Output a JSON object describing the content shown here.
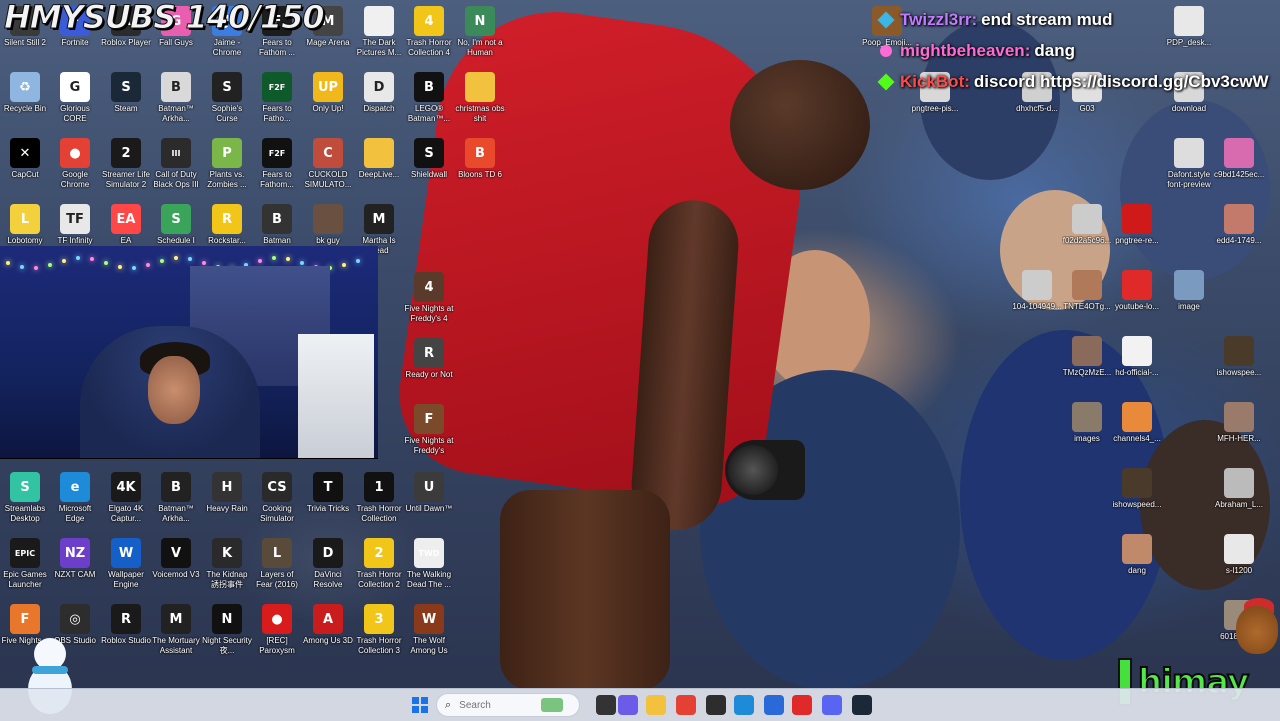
{
  "subs_counter": "HMYSUBS 140/150",
  "chat": [
    {
      "name": "Twizzl3rr:",
      "message": "end stream mud",
      "color": "#c07bff"
    },
    {
      "name": "mightbeheaven:",
      "message": "dang",
      "color": "#ff6bd6"
    },
    {
      "name": "KickBot:",
      "message": "discord https://discord.gg/Cbv3cwW",
      "color": "#ff4a4a"
    }
  ],
  "desktop_icons_left": [
    {
      "label": "Silent Still 2",
      "icon": "game-icon",
      "color": "#3a3a3a",
      "glyph": "S"
    },
    {
      "label": "Fortnite",
      "icon": "fortnite-icon",
      "color": "#3b5bd8",
      "glyph": "F"
    },
    {
      "label": "Roblox Player",
      "icon": "roblox-icon",
      "color": "#2b2b2b",
      "glyph": "R"
    },
    {
      "label": "Fall Guys",
      "icon": "fallguys-icon",
      "color": "#e85fb0",
      "glyph": "G"
    },
    {
      "label": "Jaime - Chrome",
      "icon": "chrome-icon",
      "color": "#3d7de0",
      "glyph": "J"
    },
    {
      "label": "Fears to Fathom ...",
      "icon": "game-icon",
      "color": "#1c1c1c",
      "glyph": "F"
    },
    {
      "label": "Mage Arena",
      "icon": "game-icon",
      "color": "#444",
      "glyph": "M"
    },
    {
      "label": "The Dark Pictures M...",
      "icon": "document-icon",
      "color": "#f0f0f0",
      "glyph": ""
    },
    {
      "label": "Trash Horror Collection 4",
      "icon": "game-icon",
      "color": "#f2c619",
      "glyph": "4"
    },
    {
      "label": "No, I'm not a Human",
      "icon": "game-icon",
      "color": "#3a8a5a",
      "glyph": "N"
    },
    {
      "label": "Recycle Bin",
      "icon": "recycle-bin-icon",
      "color": "#8fb6e0",
      "glyph": "♻"
    },
    {
      "label": "Glorious CORE",
      "icon": "glorious-icon",
      "color": "#ffffff",
      "glyph": "G"
    },
    {
      "label": "Steam",
      "icon": "steam-icon",
      "color": "#1b2838",
      "glyph": "S"
    },
    {
      "label": "Batman™ Arkha...",
      "icon": "game-icon",
      "color": "#d9d9d9",
      "glyph": "B"
    },
    {
      "label": "Sophie's Curse",
      "icon": "game-icon",
      "color": "#222",
      "glyph": "S"
    },
    {
      "label": "Fears to Fatho...",
      "icon": "game-icon",
      "color": "#0f5a2a",
      "glyph": "F2F"
    },
    {
      "label": "Only Up!",
      "icon": "game-icon",
      "color": "#f0b81a",
      "glyph": "UP"
    },
    {
      "label": "Dispatch",
      "icon": "game-icon",
      "color": "#e8e8e8",
      "glyph": "D"
    },
    {
      "label": "LEGO® Batman™...",
      "icon": "game-icon",
      "color": "#111",
      "glyph": "B"
    },
    {
      "label": "christmas obs shit",
      "icon": "folder-icon",
      "color": "#f2c13d",
      "glyph": ""
    },
    {
      "label": "CapCut",
      "icon": "capcut-icon",
      "color": "#000",
      "glyph": "✕"
    },
    {
      "label": "Google Chrome",
      "icon": "chrome-icon",
      "color": "#e44134",
      "glyph": "●"
    },
    {
      "label": "Streamer Life Simulator 2",
      "icon": "game-icon",
      "color": "#1a1a1a",
      "glyph": "2"
    },
    {
      "label": "Call of Duty Black Ops III",
      "icon": "game-icon",
      "color": "#2b2b2b",
      "glyph": "III"
    },
    {
      "label": "Plants vs. Zombies ...",
      "icon": "game-icon",
      "color": "#7ab648",
      "glyph": "P"
    },
    {
      "label": "Fears to Fathom...",
      "icon": "game-icon",
      "color": "#111",
      "glyph": "F2F"
    },
    {
      "label": "CUCKOLD SIMULATO...",
      "icon": "game-icon",
      "color": "#c04c3c",
      "glyph": "C"
    },
    {
      "label": "DeepLive...",
      "icon": "folder-icon",
      "color": "#f2c13d",
      "glyph": ""
    },
    {
      "label": "Shieldwall",
      "icon": "game-icon",
      "color": "#111",
      "glyph": "S"
    },
    {
      "label": "Bloons TD 6",
      "icon": "game-icon",
      "color": "#e84a2b",
      "glyph": "B"
    },
    {
      "label": "Lobotomy",
      "icon": "game-icon",
      "color": "#f2d13d",
      "glyph": "L"
    },
    {
      "label": "TF Infinity",
      "icon": "game-icon",
      "color": "#e8e8e8",
      "glyph": "TF"
    },
    {
      "label": "EA",
      "icon": "ea-icon",
      "color": "#ff4747",
      "glyph": "EA"
    },
    {
      "label": "Schedule I",
      "icon": "game-icon",
      "color": "#3aa45a",
      "glyph": "S"
    },
    {
      "label": "Rockstar...",
      "icon": "rockstar-icon",
      "color": "#f2c619",
      "glyph": "R"
    },
    {
      "label": "Batman The...",
      "icon": "game-icon",
      "color": "#333",
      "glyph": "B"
    },
    {
      "label": "bk guy",
      "icon": "image-icon",
      "color": "#6a5040",
      "glyph": ""
    },
    {
      "label": "Martha Is Dead",
      "icon": "game-icon",
      "color": "#222",
      "glyph": "M"
    }
  ],
  "desktop_icons_bottom": [
    {
      "label": "Streamlabs Desktop",
      "icon": "streamlabs-icon",
      "color": "#31c3a2",
      "glyph": "S"
    },
    {
      "label": "Microsoft Edge",
      "icon": "edge-icon",
      "color": "#1e8bd8",
      "glyph": "e"
    },
    {
      "label": "Elgato 4K Captur...",
      "icon": "elgato-icon",
      "color": "#1a1a1a",
      "glyph": "4K"
    },
    {
      "label": "Batman™ Arkha...",
      "icon": "game-icon",
      "color": "#222",
      "glyph": "B"
    },
    {
      "label": "Heavy Rain",
      "icon": "game-icon",
      "color": "#333",
      "glyph": "H"
    },
    {
      "label": "Cooking Simulator",
      "icon": "game-icon",
      "color": "#2a2a2a",
      "glyph": "CS"
    },
    {
      "label": "Trivia Tricks",
      "icon": "game-icon",
      "color": "#111",
      "glyph": "T"
    },
    {
      "label": "Trash Horror Collection",
      "icon": "game-icon",
      "color": "#111",
      "glyph": "1"
    },
    {
      "label": "Until Dawn™",
      "icon": "game-icon",
      "color": "#3b3b3b",
      "glyph": "U"
    },
    {
      "label": "Epic Games Launcher",
      "icon": "epic-icon",
      "color": "#1a1a1a",
      "glyph": "EPIC"
    },
    {
      "label": "NZXT CAM",
      "icon": "nzxt-icon",
      "color": "#6c3ec9",
      "glyph": "NZ"
    },
    {
      "label": "Wallpaper Engine",
      "icon": "wallpaper-engine-icon",
      "color": "#1560c8",
      "glyph": "W"
    },
    {
      "label": "Voicemod V3",
      "icon": "voicemod-icon",
      "color": "#111",
      "glyph": "V"
    },
    {
      "label": "The Kidnap 誘拐事件",
      "icon": "game-icon",
      "color": "#2a2a2a",
      "glyph": "K"
    },
    {
      "label": "Layers of Fear (2016)",
      "icon": "game-icon",
      "color": "#5a4a3a",
      "glyph": "L"
    },
    {
      "label": "DaVinci Resolve",
      "icon": "davinci-icon",
      "color": "#1a1a1a",
      "glyph": "D"
    },
    {
      "label": "Trash Horror Collection 2",
      "icon": "game-icon",
      "color": "#f2c619",
      "glyph": "2"
    },
    {
      "label": "The Walking Dead The ...",
      "icon": "game-icon",
      "color": "#eee",
      "glyph": "TWD"
    },
    {
      "label": "Five Nights...",
      "icon": "game-icon",
      "color": "#e8762b",
      "glyph": "F"
    },
    {
      "label": "OBS Studio",
      "icon": "obs-icon",
      "color": "#2d2d2d",
      "glyph": "◎"
    },
    {
      "label": "Roblox Studio",
      "icon": "roblox-studio-icon",
      "color": "#1a1a1a",
      "glyph": "R"
    },
    {
      "label": "The Mortuary Assistant",
      "icon": "game-icon",
      "color": "#222",
      "glyph": "M"
    },
    {
      "label": "Night Security 夜...",
      "icon": "game-icon",
      "color": "#111",
      "glyph": "N"
    },
    {
      "label": "[REC] Paroxysm",
      "icon": "game-icon",
      "color": "#d81b1b",
      "glyph": "●"
    },
    {
      "label": "Among Us 3D",
      "icon": "game-icon",
      "color": "#c91d1d",
      "glyph": "A"
    },
    {
      "label": "Trash Horror Collection 3",
      "icon": "game-icon",
      "color": "#f2c619",
      "glyph": "3"
    },
    {
      "label": "The Wolf Among Us",
      "icon": "game-icon",
      "color": "#8a3a1a",
      "glyph": "W"
    }
  ],
  "desktop_icons_middle": [
    {
      "label": "Five Nights at Freddy's 4",
      "icon": "game-icon",
      "color": "#5a3a2a",
      "glyph": "4"
    },
    {
      "label": "Ready or Not",
      "icon": "game-icon",
      "color": "#444",
      "glyph": "R"
    },
    {
      "label": "Five Nights at Freddy's",
      "icon": "game-icon",
      "color": "#7a4a2a",
      "glyph": "F"
    }
  ],
  "desktop_icons_right": [
    {
      "label": "Poop_Emoji...",
      "icon": "image-icon",
      "color": "#8a5a2a",
      "glyph": ""
    },
    {
      "label": "PDP_desk...",
      "icon": "image-icon",
      "color": "#e8e8e8",
      "glyph": ""
    },
    {
      "label": "pngtree-pis...",
      "icon": "image-icon",
      "color": "#d8d8d8",
      "glyph": ""
    },
    {
      "label": "dhxhcf5-d...",
      "icon": "image-icon",
      "color": "#d0d0d0",
      "glyph": ""
    },
    {
      "label": "G03",
      "icon": "image-icon",
      "color": "#e0e0e0",
      "glyph": ""
    },
    {
      "label": "download",
      "icon": "image-icon",
      "color": "#d8d8d8",
      "glyph": ""
    },
    {
      "label": "Dafont.style font-preview",
      "icon": "image-icon",
      "color": "#ddd",
      "glyph": ""
    },
    {
      "label": "c9bd1425ec...",
      "icon": "image-icon",
      "color": "#d86ab0",
      "glyph": ""
    },
    {
      "label": "f02d2a5c96...",
      "icon": "image-icon",
      "color": "#ccc",
      "glyph": ""
    },
    {
      "label": "pngtree-re...",
      "icon": "image-icon",
      "color": "#d01a1a",
      "glyph": ""
    },
    {
      "label": "edd4-1749...",
      "icon": "image-icon",
      "color": "#c47a6a",
      "glyph": ""
    },
    {
      "label": "104-104949...",
      "icon": "image-icon",
      "color": "#ccc",
      "glyph": ""
    },
    {
      "label": "TNTE4OTg...",
      "icon": "image-icon",
      "color": "#b07a5a",
      "glyph": ""
    },
    {
      "label": "youtube-lo...",
      "icon": "image-icon",
      "color": "#e02a2a",
      "glyph": ""
    },
    {
      "label": "image",
      "icon": "image-icon",
      "color": "#7a9ac0",
      "glyph": ""
    },
    {
      "label": "TMzQzMzE...",
      "icon": "image-icon",
      "color": "#8a6a5a",
      "glyph": ""
    },
    {
      "label": "hd-official-...",
      "icon": "image-icon",
      "color": "#f2f2f2",
      "glyph": ""
    },
    {
      "label": "ishowspee...",
      "icon": "image-icon",
      "color": "#4a3a2a",
      "glyph": ""
    },
    {
      "label": "images",
      "icon": "image-icon",
      "color": "#8a7a6a",
      "glyph": ""
    },
    {
      "label": "channels4_...",
      "icon": "image-icon",
      "color": "#e88a3a",
      "glyph": ""
    },
    {
      "label": "MFH-HER...",
      "icon": "image-icon",
      "color": "#9a7a6a",
      "glyph": ""
    },
    {
      "label": "ishowspeed...",
      "icon": "image-icon",
      "color": "#4a3a2a",
      "glyph": ""
    },
    {
      "label": "Abraham_L...",
      "icon": "image-icon",
      "color": "#bbb",
      "glyph": ""
    },
    {
      "label": "dang",
      "icon": "image-icon",
      "color": "#c08a6a",
      "glyph": ""
    },
    {
      "label": "s-l1200",
      "icon": "image-icon",
      "color": "#e8e8e8",
      "glyph": ""
    },
    {
      "label": "60182ee...",
      "icon": "image-icon",
      "color": "#9a8a7a",
      "glyph": ""
    }
  ],
  "taskbar": {
    "search_placeholder": "Search",
    "apps": [
      {
        "icon": "windows-start-icon",
        "color": "#1a73e8"
      },
      {
        "icon": "task-view-icon",
        "color": "#333"
      },
      {
        "icon": "copilot-icon",
        "color": "#6b5be8"
      },
      {
        "icon": "file-explorer-icon",
        "color": "#f2c13d"
      },
      {
        "icon": "chrome-icon",
        "color": "#e44134"
      },
      {
        "icon": "obs-icon",
        "color": "#2d2d2d"
      },
      {
        "icon": "edge-icon",
        "color": "#1e8bd8"
      },
      {
        "icon": "store-icon",
        "color": "#2a6ad8"
      },
      {
        "icon": "youtube-icon",
        "color": "#e02a2a"
      },
      {
        "icon": "discord-icon",
        "color": "#5865f2"
      },
      {
        "icon": "steam-icon",
        "color": "#1b2838"
      }
    ]
  },
  "brand_watermark": "himay"
}
